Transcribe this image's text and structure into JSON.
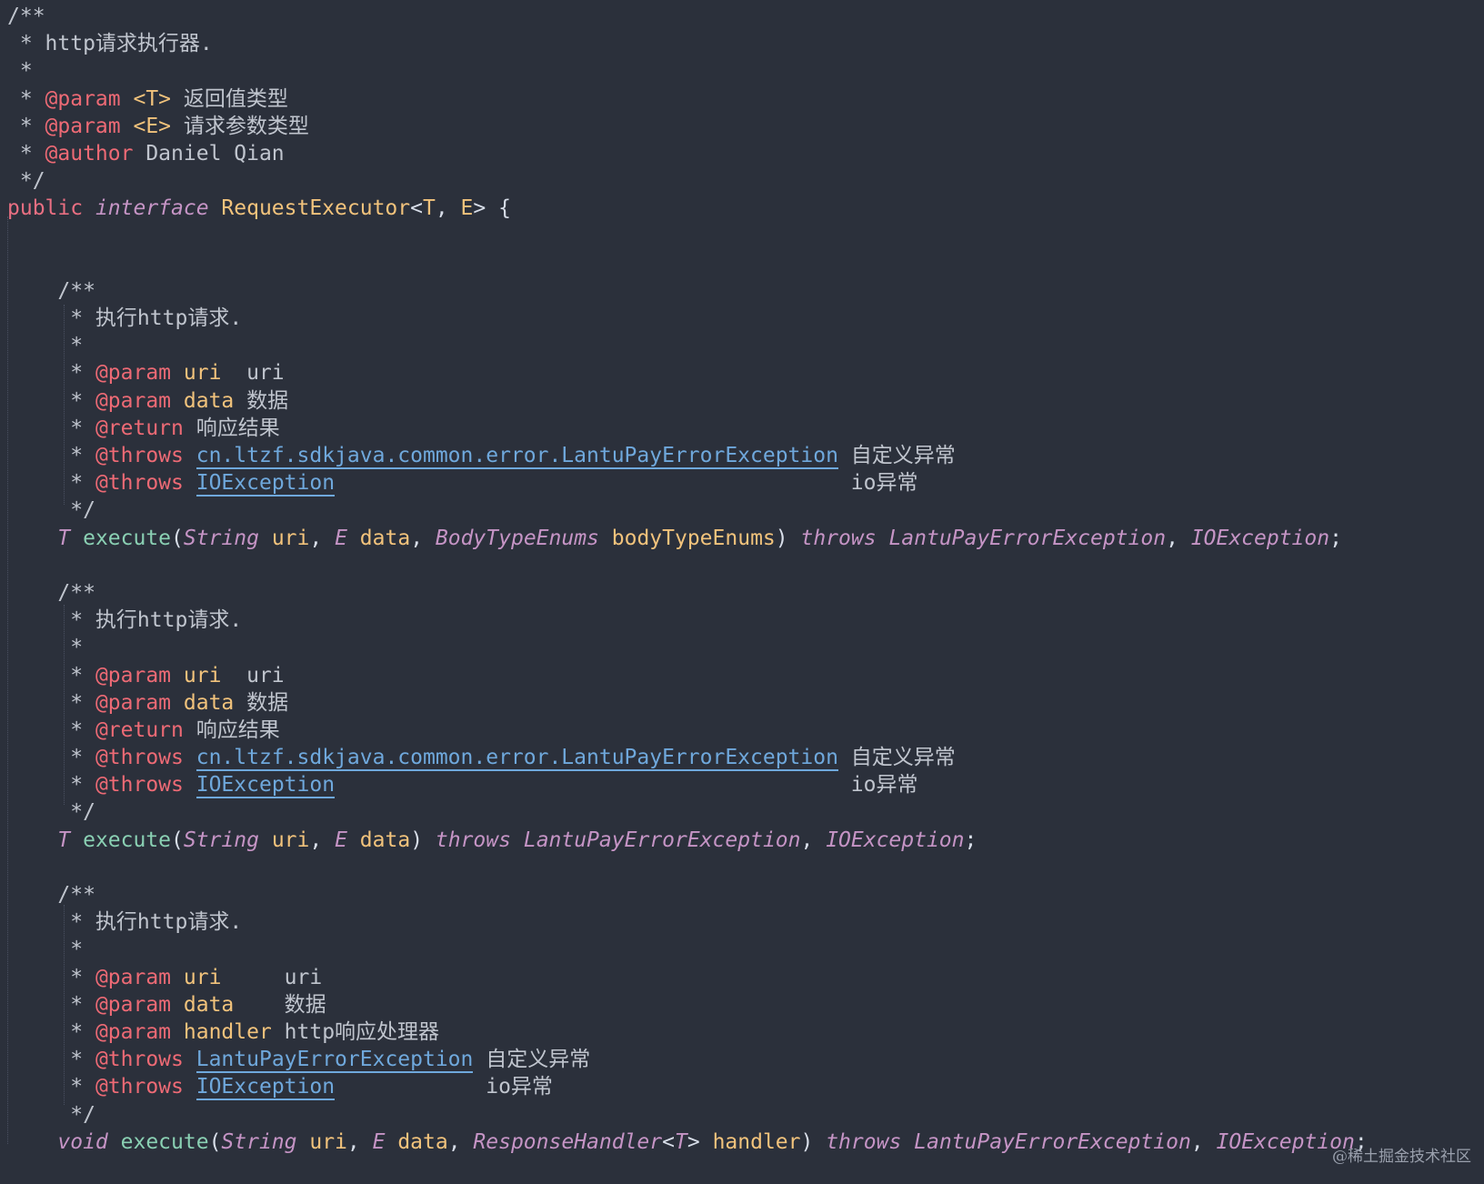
{
  "colors": {
    "background": "#2b303b",
    "comment": "#c0c5ce",
    "tag": "#ed6a75",
    "param_name": "#f2c37c",
    "link": "#6fa8dc",
    "keyword": "#e96f82",
    "type": "#c594c5",
    "class_name": "#f2c37c",
    "method": "#8ad0b3",
    "default": "#d8dee9"
  },
  "watermark": "@稀土掘金技术社区",
  "lines": [
    [
      {
        "t": "/**",
        "c": "comment"
      }
    ],
    [
      {
        "t": " * http请求执行器.",
        "c": "comment"
      }
    ],
    [
      {
        "t": " *",
        "c": "comment"
      }
    ],
    [
      {
        "t": " * ",
        "c": "comment"
      },
      {
        "t": "@param",
        "c": "tag"
      },
      {
        "t": " <T>",
        "c": "param_name"
      },
      {
        "t": " 返回值类型",
        "c": "comment"
      }
    ],
    [
      {
        "t": " * ",
        "c": "comment"
      },
      {
        "t": "@param",
        "c": "tag"
      },
      {
        "t": " <E>",
        "c": "param_name"
      },
      {
        "t": " 请求参数类型",
        "c": "comment"
      }
    ],
    [
      {
        "t": " * ",
        "c": "comment"
      },
      {
        "t": "@author",
        "c": "tag"
      },
      {
        "t": " Daniel Qian",
        "c": "comment"
      }
    ],
    [
      {
        "t": " */",
        "c": "comment"
      }
    ],
    [
      {
        "t": "public ",
        "c": "keyword"
      },
      {
        "t": "interface",
        "c": "type",
        "i": true
      },
      {
        "t": " RequestExecutor",
        "c": "class_name"
      },
      {
        "t": "<",
        "c": "default"
      },
      {
        "t": "T",
        "c": "class_name"
      },
      {
        "t": ", ",
        "c": "default"
      },
      {
        "t": "E",
        "c": "class_name"
      },
      {
        "t": "> {",
        "c": "default"
      }
    ],
    [],
    [],
    [
      {
        "t": "    /**",
        "c": "comment"
      }
    ],
    [
      {
        "t": "     * 执行http请求.",
        "c": "comment"
      }
    ],
    [
      {
        "t": "     *",
        "c": "comment"
      }
    ],
    [
      {
        "t": "     * ",
        "c": "comment"
      },
      {
        "t": "@param",
        "c": "tag"
      },
      {
        "t": " uri",
        "c": "param_name"
      },
      {
        "t": "  uri",
        "c": "comment"
      }
    ],
    [
      {
        "t": "     * ",
        "c": "comment"
      },
      {
        "t": "@param",
        "c": "tag"
      },
      {
        "t": " data",
        "c": "param_name"
      },
      {
        "t": " 数据",
        "c": "comment"
      }
    ],
    [
      {
        "t": "     * ",
        "c": "comment"
      },
      {
        "t": "@return",
        "c": "tag"
      },
      {
        "t": " 响应结果",
        "c": "comment"
      }
    ],
    [
      {
        "t": "     * ",
        "c": "comment"
      },
      {
        "t": "@throws",
        "c": "tag"
      },
      {
        "t": " ",
        "c": "comment"
      },
      {
        "t": "cn.ltzf.sdkjava.common.error.LantuPayErrorException",
        "c": "link",
        "u": true
      },
      {
        "t": " 自定义异常",
        "c": "comment"
      }
    ],
    [
      {
        "t": "     * ",
        "c": "comment"
      },
      {
        "t": "@throws",
        "c": "tag"
      },
      {
        "t": " ",
        "c": "comment"
      },
      {
        "t": "IOException",
        "c": "link",
        "u": true
      },
      {
        "t": "                                         io异常",
        "c": "comment"
      }
    ],
    [
      {
        "t": "     */",
        "c": "comment"
      }
    ],
    [
      {
        "t": "    ",
        "c": "default"
      },
      {
        "t": "T",
        "c": "type",
        "i": true
      },
      {
        "t": " execute",
        "c": "method"
      },
      {
        "t": "(",
        "c": "default"
      },
      {
        "t": "String",
        "c": "type",
        "i": true
      },
      {
        "t": " uri",
        "c": "param_name"
      },
      {
        "t": ", ",
        "c": "default"
      },
      {
        "t": "E",
        "c": "type",
        "i": true
      },
      {
        "t": " data",
        "c": "param_name"
      },
      {
        "t": ", ",
        "c": "default"
      },
      {
        "t": "BodyTypeEnums",
        "c": "type",
        "i": true
      },
      {
        "t": " bodyTypeEnums",
        "c": "param_name"
      },
      {
        "t": ") ",
        "c": "default"
      },
      {
        "t": "throws",
        "c": "type",
        "i": true
      },
      {
        "t": " ",
        "c": "default"
      },
      {
        "t": "LantuPayErrorException",
        "c": "type",
        "i": true
      },
      {
        "t": ", ",
        "c": "default"
      },
      {
        "t": "IOException",
        "c": "type",
        "i": true
      },
      {
        "t": ";",
        "c": "default"
      }
    ],
    [],
    [
      {
        "t": "    /**",
        "c": "comment"
      }
    ],
    [
      {
        "t": "     * 执行http请求.",
        "c": "comment"
      }
    ],
    [
      {
        "t": "     *",
        "c": "comment"
      }
    ],
    [
      {
        "t": "     * ",
        "c": "comment"
      },
      {
        "t": "@param",
        "c": "tag"
      },
      {
        "t": " uri",
        "c": "param_name"
      },
      {
        "t": "  uri",
        "c": "comment"
      }
    ],
    [
      {
        "t": "     * ",
        "c": "comment"
      },
      {
        "t": "@param",
        "c": "tag"
      },
      {
        "t": " data",
        "c": "param_name"
      },
      {
        "t": " 数据",
        "c": "comment"
      }
    ],
    [
      {
        "t": "     * ",
        "c": "comment"
      },
      {
        "t": "@return",
        "c": "tag"
      },
      {
        "t": " 响应结果",
        "c": "comment"
      }
    ],
    [
      {
        "t": "     * ",
        "c": "comment"
      },
      {
        "t": "@throws",
        "c": "tag"
      },
      {
        "t": " ",
        "c": "comment"
      },
      {
        "t": "cn.ltzf.sdkjava.common.error.LantuPayErrorException",
        "c": "link",
        "u": true
      },
      {
        "t": " 自定义异常",
        "c": "comment"
      }
    ],
    [
      {
        "t": "     * ",
        "c": "comment"
      },
      {
        "t": "@throws",
        "c": "tag"
      },
      {
        "t": " ",
        "c": "comment"
      },
      {
        "t": "IOException",
        "c": "link",
        "u": true
      },
      {
        "t": "                                         io异常",
        "c": "comment"
      }
    ],
    [
      {
        "t": "     */",
        "c": "comment"
      }
    ],
    [
      {
        "t": "    ",
        "c": "default"
      },
      {
        "t": "T",
        "c": "type",
        "i": true
      },
      {
        "t": " execute",
        "c": "method"
      },
      {
        "t": "(",
        "c": "default"
      },
      {
        "t": "String",
        "c": "type",
        "i": true
      },
      {
        "t": " uri",
        "c": "param_name"
      },
      {
        "t": ", ",
        "c": "default"
      },
      {
        "t": "E",
        "c": "type",
        "i": true
      },
      {
        "t": " data",
        "c": "param_name"
      },
      {
        "t": ") ",
        "c": "default"
      },
      {
        "t": "throws",
        "c": "type",
        "i": true
      },
      {
        "t": " ",
        "c": "default"
      },
      {
        "t": "LantuPayErrorException",
        "c": "type",
        "i": true
      },
      {
        "t": ", ",
        "c": "default"
      },
      {
        "t": "IOException",
        "c": "type",
        "i": true
      },
      {
        "t": ";",
        "c": "default"
      }
    ],
    [],
    [
      {
        "t": "    /**",
        "c": "comment"
      }
    ],
    [
      {
        "t": "     * 执行http请求.",
        "c": "comment"
      }
    ],
    [
      {
        "t": "     *",
        "c": "comment"
      }
    ],
    [
      {
        "t": "     * ",
        "c": "comment"
      },
      {
        "t": "@param",
        "c": "tag"
      },
      {
        "t": " uri",
        "c": "param_name"
      },
      {
        "t": "     uri",
        "c": "comment"
      }
    ],
    [
      {
        "t": "     * ",
        "c": "comment"
      },
      {
        "t": "@param",
        "c": "tag"
      },
      {
        "t": " data",
        "c": "param_name"
      },
      {
        "t": "    数据",
        "c": "comment"
      }
    ],
    [
      {
        "t": "     * ",
        "c": "comment"
      },
      {
        "t": "@param",
        "c": "tag"
      },
      {
        "t": " handler",
        "c": "param_name"
      },
      {
        "t": " http响应处理器",
        "c": "comment"
      }
    ],
    [
      {
        "t": "     * ",
        "c": "comment"
      },
      {
        "t": "@throws",
        "c": "tag"
      },
      {
        "t": " ",
        "c": "comment"
      },
      {
        "t": "LantuPayErrorException",
        "c": "link",
        "u": true
      },
      {
        "t": " 自定义异常",
        "c": "comment"
      }
    ],
    [
      {
        "t": "     * ",
        "c": "comment"
      },
      {
        "t": "@throws",
        "c": "tag"
      },
      {
        "t": " ",
        "c": "comment"
      },
      {
        "t": "IOException",
        "c": "link",
        "u": true
      },
      {
        "t": "            io异常",
        "c": "comment"
      }
    ],
    [
      {
        "t": "     */",
        "c": "comment"
      }
    ],
    [
      {
        "t": "    ",
        "c": "default"
      },
      {
        "t": "void",
        "c": "type",
        "i": true
      },
      {
        "t": " execute",
        "c": "method"
      },
      {
        "t": "(",
        "c": "default"
      },
      {
        "t": "String",
        "c": "type",
        "i": true
      },
      {
        "t": " uri",
        "c": "param_name"
      },
      {
        "t": ", ",
        "c": "default"
      },
      {
        "t": "E",
        "c": "type",
        "i": true
      },
      {
        "t": " data",
        "c": "param_name"
      },
      {
        "t": ", ",
        "c": "default"
      },
      {
        "t": "ResponseHandler",
        "c": "type",
        "i": true
      },
      {
        "t": "<",
        "c": "default"
      },
      {
        "t": "T",
        "c": "type",
        "i": true
      },
      {
        "t": ">",
        "c": "default"
      },
      {
        "t": " handler",
        "c": "param_name"
      },
      {
        "t": ") ",
        "c": "default"
      },
      {
        "t": "throws",
        "c": "type",
        "i": true
      },
      {
        "t": " ",
        "c": "default"
      },
      {
        "t": "LantuPayErrorException",
        "c": "type",
        "i": true
      },
      {
        "t": ", ",
        "c": "default"
      },
      {
        "t": "IOException",
        "c": "type",
        "i": true
      },
      {
        "t": ";",
        "c": "default"
      }
    ],
    [],
    [
      {
        "t": "}",
        "c": "default"
      }
    ]
  ]
}
